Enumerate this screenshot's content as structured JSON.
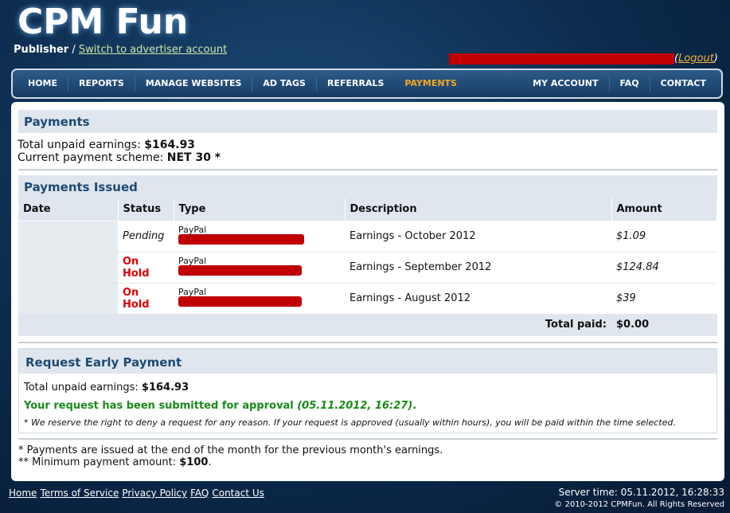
{
  "header": {
    "logo": "CPM Fun",
    "role": "Publisher",
    "sep": " / ",
    "switch_link": "Switch to advertiser account",
    "logout": "Logout"
  },
  "nav": [
    {
      "label": "HOME"
    },
    {
      "label": "REPORTS"
    },
    {
      "label": "MANAGE WEBSITES"
    },
    {
      "label": "AD TAGS"
    },
    {
      "label": "REFERRALS"
    },
    {
      "label": "PAYMENTS",
      "active": true
    },
    {
      "label": "MY ACCOUNT"
    },
    {
      "label": "FAQ"
    },
    {
      "label": "CONTACT"
    }
  ],
  "payments": {
    "title": "Payments",
    "unpaid_label": "Total unpaid earnings: ",
    "unpaid_value": "$164.93",
    "scheme_label": "Current payment scheme: ",
    "scheme_value": "NET 30 *"
  },
  "issued": {
    "title": "Payments Issued",
    "columns": [
      "Date",
      "Status",
      "Type",
      "Description",
      "Amount"
    ],
    "rows": [
      {
        "date": "",
        "status": "Pending",
        "type": "PayPal",
        "description": "Earnings - October 2012",
        "amount": "$1.09"
      },
      {
        "date": "",
        "status": "On Hold",
        "type": "PayPal",
        "description": "Earnings - September 2012",
        "amount": "$124.84"
      },
      {
        "date": "",
        "status": "On Hold",
        "type": "PayPal",
        "description": "Earnings - August 2012",
        "amount": "$39"
      }
    ],
    "total_label": "Total paid:",
    "total_value": "$0.00"
  },
  "early": {
    "title": "Request Early Payment",
    "unpaid_label": "Total unpaid earnings: ",
    "unpaid_value": "$164.93",
    "message": "Your request has been submitted for approval ",
    "message_time": "(05.11.2012, 16:27)",
    "message_end": ".",
    "note": "* We reserve the right to deny a request for any reason. If your request is approved (usually within hours), you will be paid within the time selected."
  },
  "notes": {
    "line1": "* Payments are issued at the end of the month for the previous month's earnings.",
    "line2_label": "** Minimum payment amount: ",
    "line2_value": "$100",
    "line2_end": "."
  },
  "footer": {
    "links": [
      "Home",
      "Terms of Service",
      "Privacy Policy",
      "FAQ",
      "Contact Us"
    ],
    "server_time": "Server time: 05.11.2012, 16:28:33",
    "copyright": "© 2010-2012 CPMFun. All Rights Reserved"
  }
}
